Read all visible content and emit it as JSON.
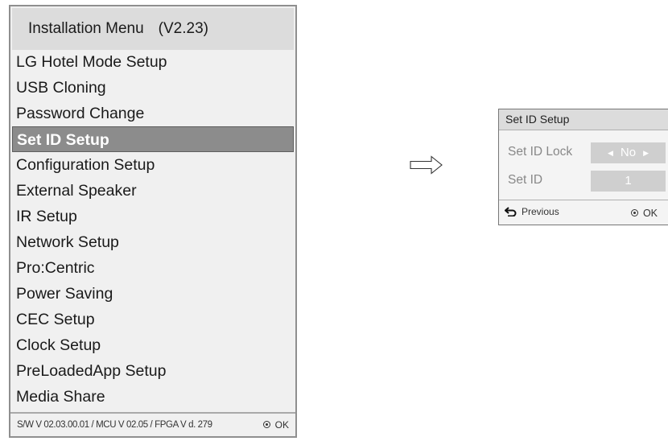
{
  "installation_menu": {
    "title": "Installation Menu",
    "version": "(V2.23)",
    "items": [
      "LG Hotel Mode Setup",
      "USB Cloning",
      "Password Change",
      "Set ID Setup",
      "Configuration Setup",
      "External Speaker",
      "IR Setup",
      "Network Setup",
      "Pro:Centric",
      "Power Saving",
      "CEC Setup",
      "Clock Setup",
      "PreLoadedApp Setup",
      "Media Share"
    ],
    "selected_item": "Set ID Setup",
    "footer_version": "S/W V 02.03.00.01 / MCU V 02.05 / FPGA V d. 279",
    "footer_ok": "OK"
  },
  "set_id_popup": {
    "title": "Set ID Setup",
    "rows": [
      {
        "label": "Set ID Lock",
        "value": "No"
      },
      {
        "label": "Set ID",
        "value": "1"
      }
    ],
    "previous_label": "Previous",
    "ok_label": "OK"
  },
  "colors": {
    "selected_bg": "#8c8c8c",
    "header_bg": "#dcdcdc",
    "value_bg": "#cfcfcf"
  }
}
